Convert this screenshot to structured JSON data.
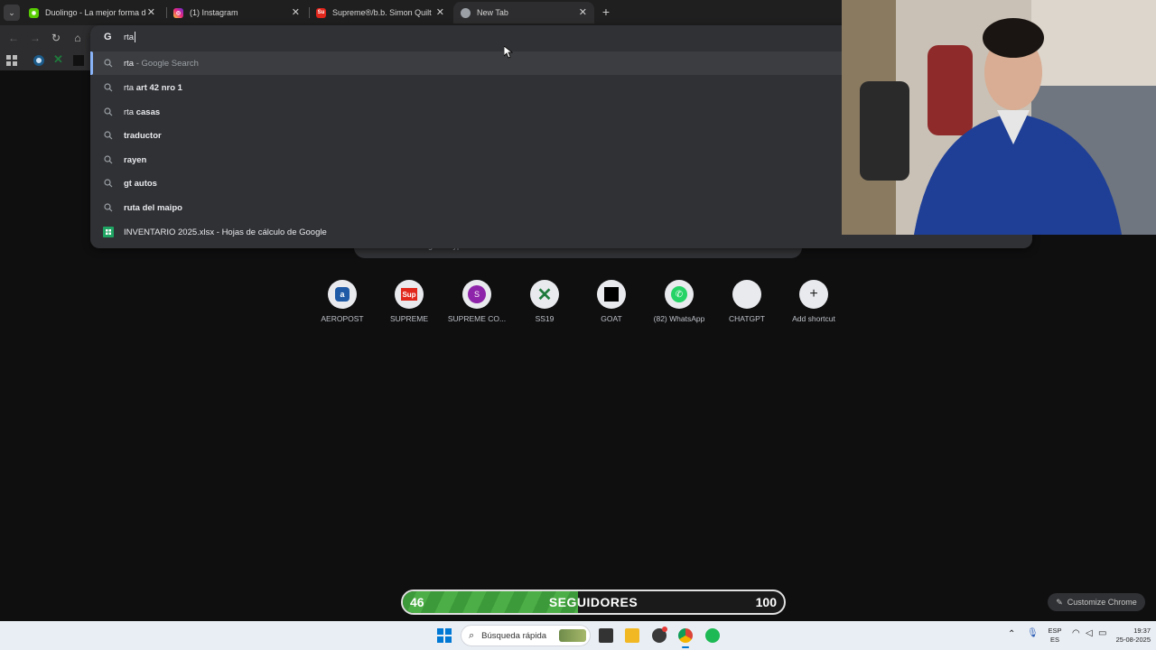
{
  "tabs": [
    {
      "title": "Duolingo - La mejor forma de a",
      "favicon": "duolingo-icon",
      "color": "#58cc02"
    },
    {
      "title": "(1) Instagram",
      "favicon": "instagram-icon",
      "color": "#d62976"
    },
    {
      "title": "Supreme®/b.b. Simon Quilted",
      "favicon": "supreme-icon",
      "color": "#e1261c"
    },
    {
      "title": "New Tab",
      "favicon": "chrome-icon",
      "color": "#9aa0a6"
    }
  ],
  "omnibox": {
    "text": "rta",
    "suggestions": [
      {
        "prefix": "rta",
        "rest": " - Google Search",
        "type": "search"
      },
      {
        "prefix": "rta",
        "rest": " art 42 nro 1",
        "type": "search"
      },
      {
        "prefix": "rta",
        "rest": " casas",
        "type": "search"
      },
      {
        "prefix": "",
        "rest": "traductor",
        "type": "search"
      },
      {
        "prefix": "",
        "rest": "rayen",
        "type": "search"
      },
      {
        "prefix": "",
        "rest": "gt autos",
        "type": "search"
      },
      {
        "prefix": "",
        "rest": "ruta del maipo",
        "type": "search"
      },
      {
        "prefix": "",
        "rest": "INVENTARIO 2025.xlsx - Hojas de cálculo de Google",
        "type": "sheets"
      }
    ]
  },
  "ntp": {
    "search_placeholder": "Search Google or type a URL",
    "shortcuts": [
      {
        "label": "AEROPOST",
        "icon": "aeropost-icon"
      },
      {
        "label": "SUPREME",
        "icon": "supreme-icon"
      },
      {
        "label": "SUPREME CO...",
        "icon": "s-letter-icon"
      },
      {
        "label": "SS19",
        "icon": "x-icon"
      },
      {
        "label": "GOAT",
        "icon": "goat-icon"
      },
      {
        "label": "(82) WhatsApp",
        "icon": "whatsapp-icon"
      },
      {
        "label": "CHATGPT",
        "icon": "blank-icon"
      },
      {
        "label": "Add shortcut",
        "icon": "plus-icon"
      }
    ],
    "customize_label": "Customize Chrome"
  },
  "followers_bar": {
    "current": "46",
    "label": "SEGUIDORES",
    "goal": "100",
    "progress": 0.46
  },
  "taskbar": {
    "search_placeholder": "Búsqueda rápida",
    "lang_top": "ESP",
    "lang_bottom": "ES",
    "time": "19:37",
    "date": "25-08-2025"
  }
}
